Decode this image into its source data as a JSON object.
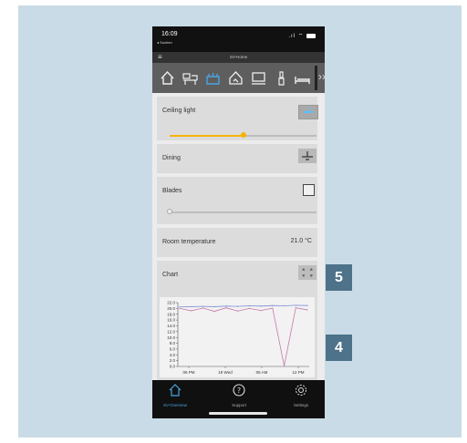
{
  "status_bar": {
    "time": "16:09",
    "back_label": "◂ Suchen",
    "signal": ".ıl",
    "wifi": "⌔"
  },
  "app": {
    "title": "SV-Home"
  },
  "room_icons": [
    "home-icon",
    "desk-icon",
    "kitchen-icon",
    "house-outline-icon",
    "tv-icon",
    "bathroom-icon",
    "bed-icon"
  ],
  "selected_room_index": 2,
  "cards": {
    "ceiling_light": {
      "label": "Ceiling light",
      "level": 0.5
    },
    "dining": {
      "label": "Dining"
    },
    "blades": {
      "label": "Blades",
      "level": 0.0
    },
    "room_temperature": {
      "label": "Room temperature",
      "value": "21.0 °C"
    },
    "chart": {
      "label": "Chart"
    }
  },
  "chart_data": {
    "type": "line",
    "x_ticks": [
      "06 PM",
      "19 Wed",
      "06 AM",
      "12 PM"
    ],
    "y_ticks": [
      "22.0",
      "20.0",
      "18.0",
      "16.0",
      "14.0",
      "12.0",
      "10.0",
      "8.0",
      "6.0",
      "4.0",
      "2.0",
      "0.0"
    ],
    "ylim": [
      0,
      22
    ],
    "series": [
      {
        "color": "#7d8fd6",
        "values": [
          20.5,
          20.6,
          20.7,
          20.6,
          20.8,
          20.7,
          20.9,
          20.8,
          21.0,
          20.9,
          21.1,
          21.0
        ]
      },
      {
        "color": "#c57aa8",
        "values": [
          20.0,
          19.2,
          20.1,
          19.0,
          20.2,
          19.1,
          20.0,
          19.3,
          20.1,
          0.2,
          20.2,
          19.5
        ]
      }
    ]
  },
  "tabs": [
    {
      "label": "SV-Overview",
      "icon": "home-icon",
      "active": true
    },
    {
      "label": "Support",
      "icon": "question-icon",
      "active": false
    },
    {
      "label": "Settings",
      "icon": "gear-icon",
      "active": false
    }
  ],
  "callouts": {
    "expand": "5",
    "chart": "4"
  },
  "colors": {
    "accent": "#f4b400",
    "tab_active": "#4aa3df",
    "callout": "#4d7289"
  }
}
